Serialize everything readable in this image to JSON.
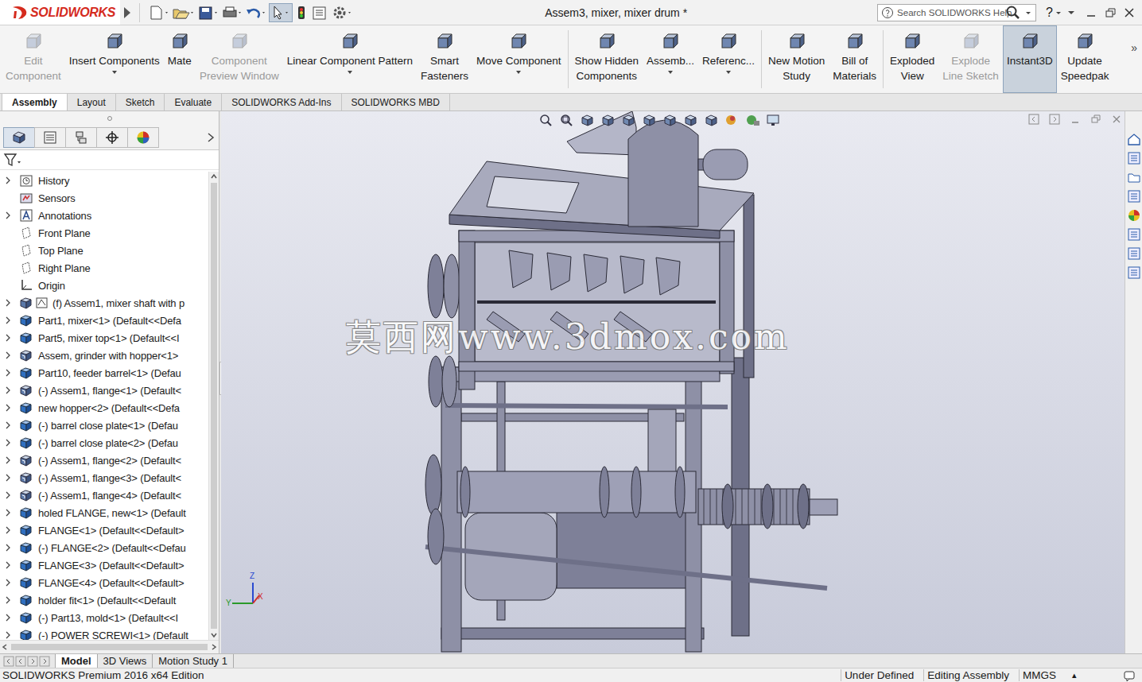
{
  "window": {
    "title": "Assem3, mixer, mixer drum *"
  },
  "brand": "SOLIDWORKS",
  "search": {
    "placeholder": "Search SOLIDWORKS Help"
  },
  "help": "?",
  "ribbon": [
    {
      "lines": [
        "Edit",
        "Component"
      ],
      "disabled": true,
      "selected": false,
      "dropdown": false,
      "separator": false
    },
    {
      "lines": [
        "Insert Components"
      ],
      "disabled": false,
      "selected": false,
      "dropdown": true,
      "separator": false
    },
    {
      "lines": [
        "Mate"
      ],
      "disabled": false,
      "selected": false,
      "dropdown": false,
      "separator": false
    },
    {
      "lines": [
        "Component",
        "Preview Window"
      ],
      "disabled": true,
      "selected": false,
      "dropdown": false,
      "separator": false
    },
    {
      "lines": [
        "Linear Component Pattern"
      ],
      "disabled": false,
      "selected": false,
      "dropdown": true,
      "separator": false
    },
    {
      "lines": [
        "Smart",
        "Fasteners"
      ],
      "disabled": false,
      "selected": false,
      "dropdown": false,
      "separator": false
    },
    {
      "lines": [
        "Move Component"
      ],
      "disabled": false,
      "selected": false,
      "dropdown": true,
      "separator": true
    },
    {
      "lines": [
        "Show Hidden",
        "Components"
      ],
      "disabled": false,
      "selected": false,
      "dropdown": false,
      "separator": false
    },
    {
      "lines": [
        "Assemb..."
      ],
      "disabled": false,
      "selected": false,
      "dropdown": true,
      "separator": false
    },
    {
      "lines": [
        "Referenc..."
      ],
      "disabled": false,
      "selected": false,
      "dropdown": true,
      "separator": true
    },
    {
      "lines": [
        "New Motion",
        "Study"
      ],
      "disabled": false,
      "selected": false,
      "dropdown": false,
      "separator": false
    },
    {
      "lines": [
        "Bill of",
        "Materials"
      ],
      "disabled": false,
      "selected": false,
      "dropdown": false,
      "separator": true
    },
    {
      "lines": [
        "Exploded",
        "View"
      ],
      "disabled": false,
      "selected": false,
      "dropdown": false,
      "separator": false
    },
    {
      "lines": [
        "Explode",
        "Line Sketch"
      ],
      "disabled": true,
      "selected": false,
      "dropdown": false,
      "separator": false
    },
    {
      "lines": [
        "Instant3D"
      ],
      "disabled": false,
      "selected": true,
      "dropdown": false,
      "separator": false
    },
    {
      "lines": [
        "Update",
        "Speedpak"
      ],
      "disabled": false,
      "selected": false,
      "dropdown": false,
      "separator": false
    }
  ],
  "ribbon_more": "»",
  "command_tabs": [
    {
      "label": "Assembly",
      "selected": true
    },
    {
      "label": "Layout",
      "selected": false
    },
    {
      "label": "Sketch",
      "selected": false
    },
    {
      "label": "Evaluate",
      "selected": false
    },
    {
      "label": "SOLIDWORKS Add-Ins",
      "selected": false
    },
    {
      "label": "SOLIDWORKS MBD",
      "selected": false
    }
  ],
  "panel_tabs": [
    {
      "selected": true
    },
    {
      "selected": false
    },
    {
      "selected": false
    },
    {
      "selected": false
    },
    {
      "selected": false
    }
  ],
  "tree": [
    {
      "label": "History",
      "kind": "history",
      "expandable": true
    },
    {
      "label": "Sensors",
      "kind": "sensor",
      "expandable": false
    },
    {
      "label": "Annotations",
      "kind": "annotation",
      "expandable": true
    },
    {
      "label": "Front Plane",
      "kind": "plane",
      "expandable": false
    },
    {
      "label": "Top Plane",
      "kind": "plane",
      "expandable": false
    },
    {
      "label": "Right Plane",
      "kind": "plane",
      "expandable": false
    },
    {
      "label": "Origin",
      "kind": "origin",
      "expandable": false
    },
    {
      "label": "(f) Assem1, mixer shaft with p",
      "kind": "subassembly",
      "expandable": true
    },
    {
      "label": "Part1, mixer<1> (Default<<Defa",
      "kind": "part",
      "expandable": true
    },
    {
      "label": "Part5, mixer top<1> (Default<<I",
      "kind": "part",
      "expandable": true
    },
    {
      "label": "Assem, grinder with hopper<1>",
      "kind": "assembly",
      "expandable": true
    },
    {
      "label": "Part10, feeder barrel<1> (Defau",
      "kind": "part",
      "expandable": true
    },
    {
      "label": "(-) Assem1, flange<1> (Default<",
      "kind": "assembly",
      "expandable": true
    },
    {
      "label": "new hopper<2> (Default<<Defa",
      "kind": "part",
      "expandable": true
    },
    {
      "label": "(-) barrel close plate<1> (Defau",
      "kind": "part",
      "expandable": true
    },
    {
      "label": "(-) barrel close plate<2> (Defau",
      "kind": "part",
      "expandable": true
    },
    {
      "label": "(-) Assem1, flange<2> (Default<",
      "kind": "assembly",
      "expandable": true
    },
    {
      "label": "(-) Assem1, flange<3> (Default<",
      "kind": "assembly",
      "expandable": true
    },
    {
      "label": "(-) Assem1, flange<4> (Default<",
      "kind": "assembly",
      "expandable": true
    },
    {
      "label": "holed FLANGE, new<1> (Default",
      "kind": "part",
      "expandable": true
    },
    {
      "label": "FLANGE<1> (Default<<Default>",
      "kind": "part",
      "expandable": true
    },
    {
      "label": "(-) FLANGE<2> (Default<<Defau",
      "kind": "part",
      "expandable": true
    },
    {
      "label": "FLANGE<3> (Default<<Default>",
      "kind": "part",
      "expandable": true
    },
    {
      "label": "FLANGE<4> (Default<<Default>",
      "kind": "part",
      "expandable": true
    },
    {
      "label": "holder fit<1> (Default<<Default",
      "kind": "part",
      "expandable": true
    },
    {
      "label": "(-) Part13, mold<1> (Default<<I",
      "kind": "part",
      "expandable": true
    },
    {
      "label": "(-) POWER SCREWI<1> (Default",
      "kind": "part",
      "expandable": true
    }
  ],
  "watermark": "莫西网www.3dmox.com",
  "triad": {
    "z": "Z",
    "y": "Y",
    "x": "X"
  },
  "bottom_tabs": [
    {
      "label": "Model",
      "selected": true
    },
    {
      "label": "3D Views",
      "selected": false
    },
    {
      "label": "Motion Study 1",
      "selected": false
    }
  ],
  "status_bar": {
    "edition": "SOLIDWORKS Premium 2016 x64 Edition",
    "fields": [
      "Under Defined",
      "Editing Assembly",
      "MMGS"
    ],
    "arrow": "▴"
  }
}
